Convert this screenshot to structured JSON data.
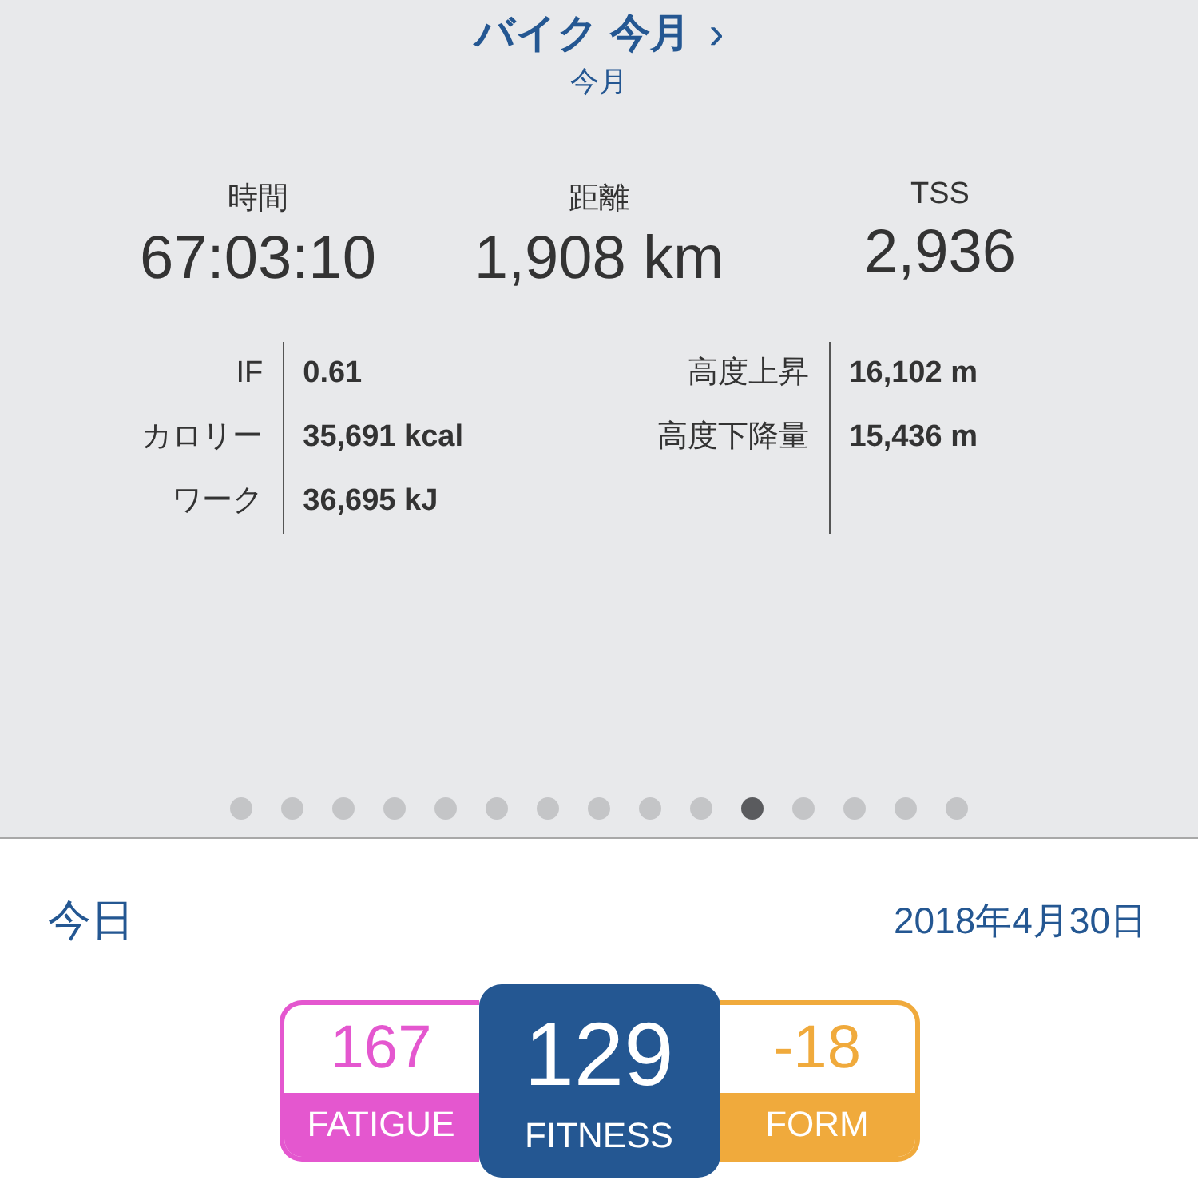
{
  "header": {
    "title": "バイク 今月",
    "chevron": "›",
    "subtitle": "今月"
  },
  "summary": [
    {
      "label": "時間",
      "value": "67:03:10"
    },
    {
      "label": "距離",
      "value": "1,908 km"
    },
    {
      "label": "TSS",
      "value": "2,936"
    }
  ],
  "details": [
    [
      {
        "label": "IF",
        "value": "0.61"
      },
      {
        "label": "カロリー",
        "value": "35,691 kcal"
      },
      {
        "label": "ワーク",
        "value": "36,695 kJ"
      }
    ],
    [
      {
        "label": "高度上昇",
        "value": "16,102 m"
      },
      {
        "label": "高度下降量",
        "value": "15,436 m"
      }
    ]
  ],
  "pages": [
    {
      "selected": false
    },
    {
      "selected": false
    },
    {
      "selected": false
    },
    {
      "selected": false
    },
    {
      "selected": false
    },
    {
      "selected": false
    },
    {
      "selected": false
    },
    {
      "selected": false
    },
    {
      "selected": false
    },
    {
      "selected": false
    },
    {
      "selected": true
    },
    {
      "selected": false
    },
    {
      "selected": false
    },
    {
      "selected": false
    },
    {
      "selected": false
    }
  ],
  "today": {
    "label": "今日",
    "date": "2018年4月30日"
  },
  "cards": [
    {
      "kind": "side",
      "value": "167",
      "label": "FATIGUE",
      "color": "#e457cf"
    },
    {
      "kind": "main",
      "value": "129",
      "label": "FITNESS",
      "color": "#245792"
    },
    {
      "kind": "side",
      "value": "-18",
      "label": "FORM",
      "color": "#f0aa3c"
    }
  ]
}
